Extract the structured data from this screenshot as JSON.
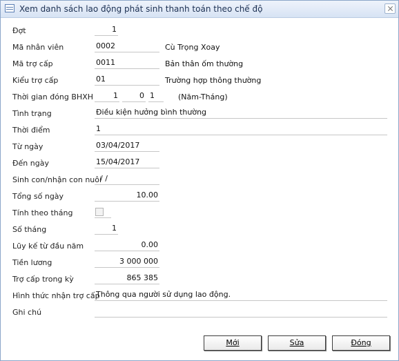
{
  "window": {
    "title": "Xem danh sách lao động phát sinh thanh toán theo chế độ"
  },
  "form": {
    "dot": {
      "label": "Đợt",
      "value": "1"
    },
    "ma_nhan_vien": {
      "label": "Mã nhân viên",
      "value": "0002",
      "name": "Cù Trọng Xoay"
    },
    "ma_tro_cap": {
      "label": "Mã trợ cấp",
      "value": "0011",
      "name": "Bản thân ốm thường"
    },
    "kieu_tro_cap": {
      "label": "Kiểu trợ cấp",
      "value": "01",
      "name": "Trường hợp thông thường"
    },
    "thoi_gian_dong": {
      "label": "Thời gian đóng BHXH",
      "years": "1",
      "month_tens": "0",
      "month_units": "1",
      "unit": "(Năm-Tháng)"
    },
    "tinh_trang": {
      "label": "Tình trạng",
      "value": "Điều kiện hưởng bình thường"
    },
    "thoi_diem": {
      "label": "Thời điểm",
      "value": "1"
    },
    "tu_ngay": {
      "label": "Từ ngày",
      "value": "03/04/2017"
    },
    "den_ngay": {
      "label": "Đến ngày",
      "value": "15/04/2017"
    },
    "sinh_con": {
      "label": "Sinh con/nhận con nuôi",
      "value": "/ /"
    },
    "tong_so_ngay": {
      "label": "Tổng số ngày",
      "value": "10.00"
    },
    "tinh_theo_thang": {
      "label": "Tính theo tháng",
      "checked": false
    },
    "so_thang": {
      "label": "Số tháng",
      "value": "1"
    },
    "luy_ke": {
      "label": "Lũy kế từ đầu năm",
      "value": "0.00"
    },
    "tien_luong": {
      "label": "Tiền lương",
      "value": "3 000 000"
    },
    "tro_cap_trong_ky": {
      "label": "Trợ cấp trong kỳ",
      "value": "865 385"
    },
    "hinh_thuc": {
      "label": "Hình thức nhận trợ cấp",
      "value": "Thông qua người sử dụng lao động."
    },
    "ghi_chu": {
      "label": "Ghi chú",
      "value": ""
    }
  },
  "buttons": {
    "new": "Mới",
    "edit": "Sửa",
    "close": "Đóng"
  }
}
